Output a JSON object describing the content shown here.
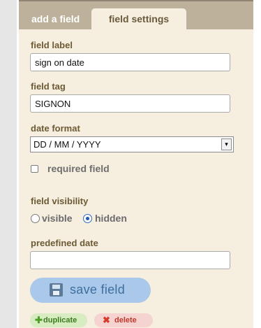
{
  "tabs": [
    {
      "label": "add a field",
      "active": false
    },
    {
      "label": "field settings",
      "active": true
    }
  ],
  "form": {
    "field_label": {
      "label": "field label",
      "value": "sign on date"
    },
    "field_tag": {
      "label": "field tag",
      "value": "SIGNON"
    },
    "date_format": {
      "label": "date format",
      "selected": "DD / MM / YYYY"
    },
    "required": {
      "label": "required field",
      "checked": false
    },
    "visibility": {
      "label": "field visibility",
      "options": [
        {
          "label": "visible",
          "selected": false
        },
        {
          "label": "hidden",
          "selected": true
        }
      ]
    },
    "predefined_date": {
      "label": "predefined date",
      "value": ""
    }
  },
  "actions": {
    "save_label": "save field",
    "duplicate_label": "duplicate",
    "delete_label": "delete"
  },
  "icons": {
    "save": "floppy-disk-icon",
    "duplicate": "plus-icon",
    "delete": "x-icon"
  },
  "colors": {
    "panel_bg": "#f6efe0",
    "tabbar_bg": "#bdb19b",
    "label_text": "#6d5a34",
    "save_button_bg": "#a9c8ea",
    "duplicate_bg": "#d8ecc2",
    "delete_bg": "#f5d3d0"
  }
}
